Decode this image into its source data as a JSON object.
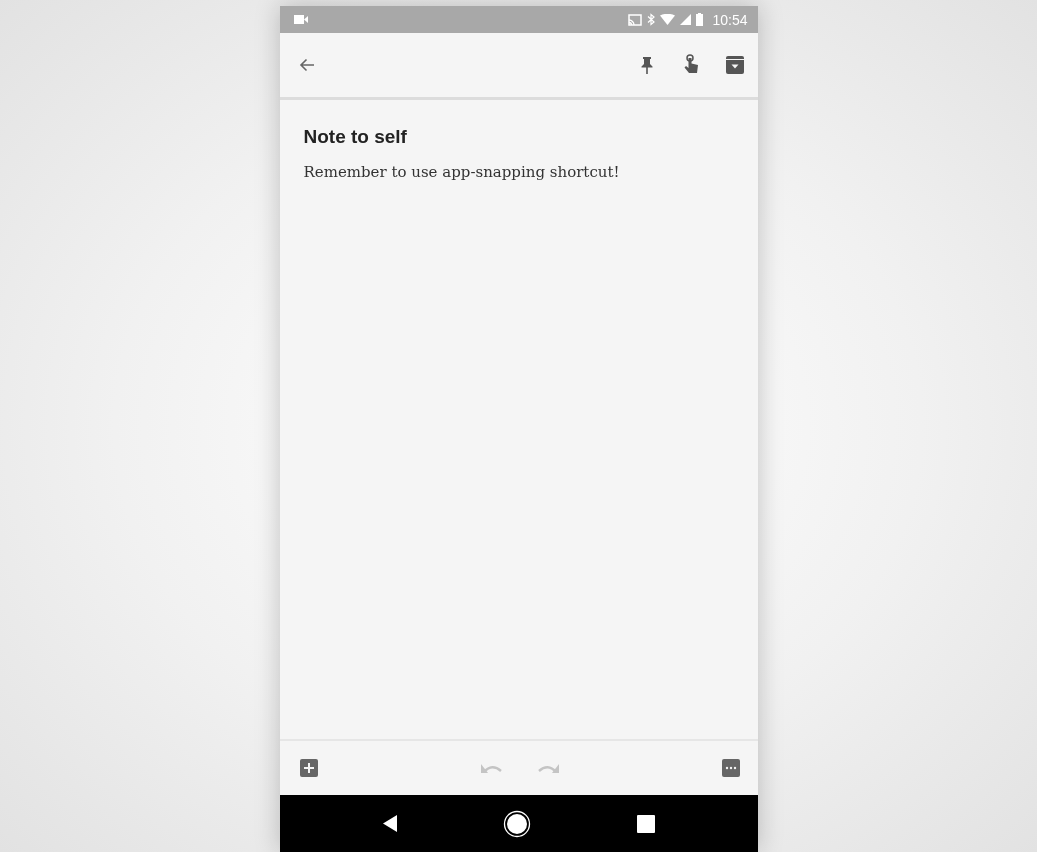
{
  "status_bar": {
    "time": "10:54"
  },
  "note": {
    "title": "Note to self",
    "body": "Remember to use app-snapping shortcut!"
  },
  "bottom_bar": {
    "undo": {
      "disabled": true
    },
    "redo": {
      "disabled": true
    }
  }
}
